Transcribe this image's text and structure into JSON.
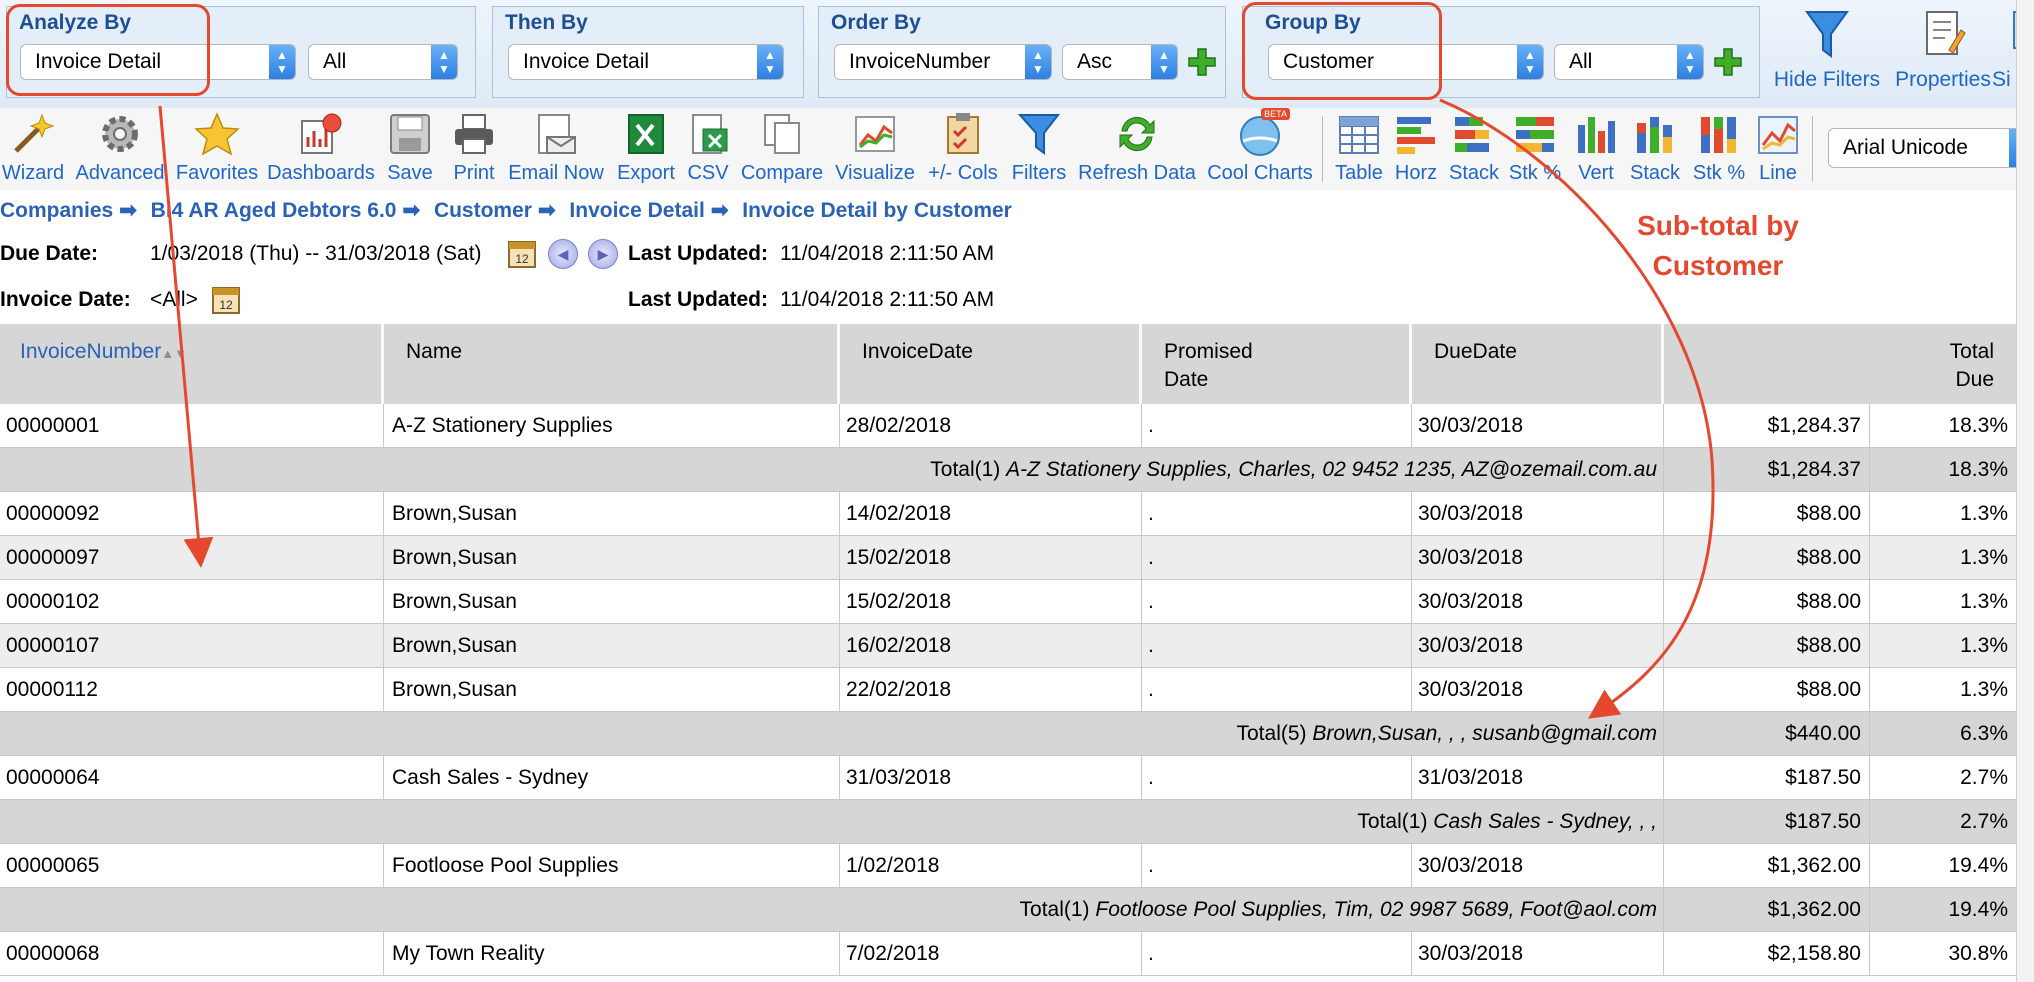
{
  "filters": {
    "analyze_by": {
      "title": "Analyze By",
      "select1": "Invoice Detail",
      "select2": "All"
    },
    "then_by": {
      "title": "Then By",
      "select1": "Invoice Detail"
    },
    "order_by": {
      "title": "Order By",
      "select1": "InvoiceNumber",
      "select2": "Asc"
    },
    "group_by": {
      "title": "Group By",
      "select1": "Customer",
      "select2": "All"
    },
    "hide_filters": "Hide Filters",
    "properties": "Properties",
    "side_partial": "Si"
  },
  "toolbar": {
    "items": [
      "Wizard",
      "Advanced",
      "Favorites",
      "Dashboards",
      "Save",
      "Print",
      "Email Now",
      "Export",
      "CSV",
      "Compare",
      "Visualize",
      "+/- Cols",
      "Filters",
      "Refresh Data",
      "Cool Charts"
    ],
    "beta_badge": "BETA",
    "chart_items": [
      "Table",
      "Horz",
      "Stack",
      "Stk %",
      "Vert",
      "Stack",
      "Stk %",
      "Line"
    ],
    "font_select": "Arial Unicode"
  },
  "breadcrumb": [
    "Companies",
    "Bi4 AR Aged Debtors 6.0",
    "Customer",
    "Invoice Detail",
    "Invoice Detail by Customer"
  ],
  "breadcrumb_sep": "➡",
  "info": {
    "due_date_label": "Due Date:",
    "due_date_value": "1/03/2018 (Thu) -- 31/03/2018 (Sat)",
    "invoice_date_label": "Invoice Date:",
    "invoice_date_value": "<All>",
    "last_updated_label": "Last Updated:",
    "last_updated_value": "11/04/2018 2:11:50 AM",
    "calendar_day": "12"
  },
  "annotation": "Sub-total by Customer",
  "table": {
    "headers": [
      "InvoiceNumber",
      "Name",
      "InvoiceDate",
      "Promised Date",
      "DueDate",
      "Total Due"
    ],
    "rows": [
      {
        "type": "data",
        "inv": "00000001",
        "name": "A-Z Stationery Supplies",
        "idate": "28/02/2018",
        "pdate": ".",
        "ddate": "30/03/2018",
        "total": "$1,284.37",
        "pct": "18.3%"
      },
      {
        "type": "total",
        "prefix": "Total(1) ",
        "label": "A-Z Stationery Supplies, Charles, 02 9452 1235, AZ@ozemail.com.au",
        "total": "$1,284.37",
        "pct": "18.3%"
      },
      {
        "type": "data",
        "inv": "00000092",
        "name": "Brown,Susan",
        "idate": "14/02/2018",
        "pdate": ".",
        "ddate": "30/03/2018",
        "total": "$88.00",
        "pct": "1.3%"
      },
      {
        "type": "data",
        "inv": "00000097",
        "name": "Brown,Susan",
        "idate": "15/02/2018",
        "pdate": ".",
        "ddate": "30/03/2018",
        "total": "$88.00",
        "pct": "1.3%"
      },
      {
        "type": "data",
        "inv": "00000102",
        "name": "Brown,Susan",
        "idate": "15/02/2018",
        "pdate": ".",
        "ddate": "30/03/2018",
        "total": "$88.00",
        "pct": "1.3%"
      },
      {
        "type": "data",
        "inv": "00000107",
        "name": "Brown,Susan",
        "idate": "16/02/2018",
        "pdate": ".",
        "ddate": "30/03/2018",
        "total": "$88.00",
        "pct": "1.3%"
      },
      {
        "type": "data",
        "inv": "00000112",
        "name": "Brown,Susan",
        "idate": "22/02/2018",
        "pdate": ".",
        "ddate": "30/03/2018",
        "total": "$88.00",
        "pct": "1.3%"
      },
      {
        "type": "total",
        "prefix": "Total(5) ",
        "label": "Brown,Susan, , , susanb@gmail.com",
        "total": "$440.00",
        "pct": "6.3%"
      },
      {
        "type": "data",
        "inv": "00000064",
        "name": "Cash Sales - Sydney",
        "idate": "31/03/2018",
        "pdate": ".",
        "ddate": "31/03/2018",
        "total": "$187.50",
        "pct": "2.7%"
      },
      {
        "type": "total",
        "prefix": "Total(1) ",
        "label": "Cash Sales - Sydney, , ,",
        "total": "$187.50",
        "pct": "2.7%"
      },
      {
        "type": "data",
        "inv": "00000065",
        "name": "Footloose Pool Supplies",
        "idate": "1/02/2018",
        "pdate": ".",
        "ddate": "30/03/2018",
        "total": "$1,362.00",
        "pct": "19.4%"
      },
      {
        "type": "total",
        "prefix": "Total(1) ",
        "label": "Footloose Pool Supplies, Tim, 02 9987 5689, Foot@aol.com",
        "total": "$1,362.00",
        "pct": "19.4%"
      },
      {
        "type": "data",
        "inv": "00000068",
        "name": "My Town Reality",
        "idate": "7/02/2018",
        "pdate": ".",
        "ddate": "30/03/2018",
        "total": "$2,158.80",
        "pct": "30.8%"
      }
    ]
  },
  "colors": {
    "accent": "#1e66c8",
    "annotation": "#e4492f",
    "header_bg": "#d6d6d6",
    "total_bg": "#d6d6d6"
  }
}
